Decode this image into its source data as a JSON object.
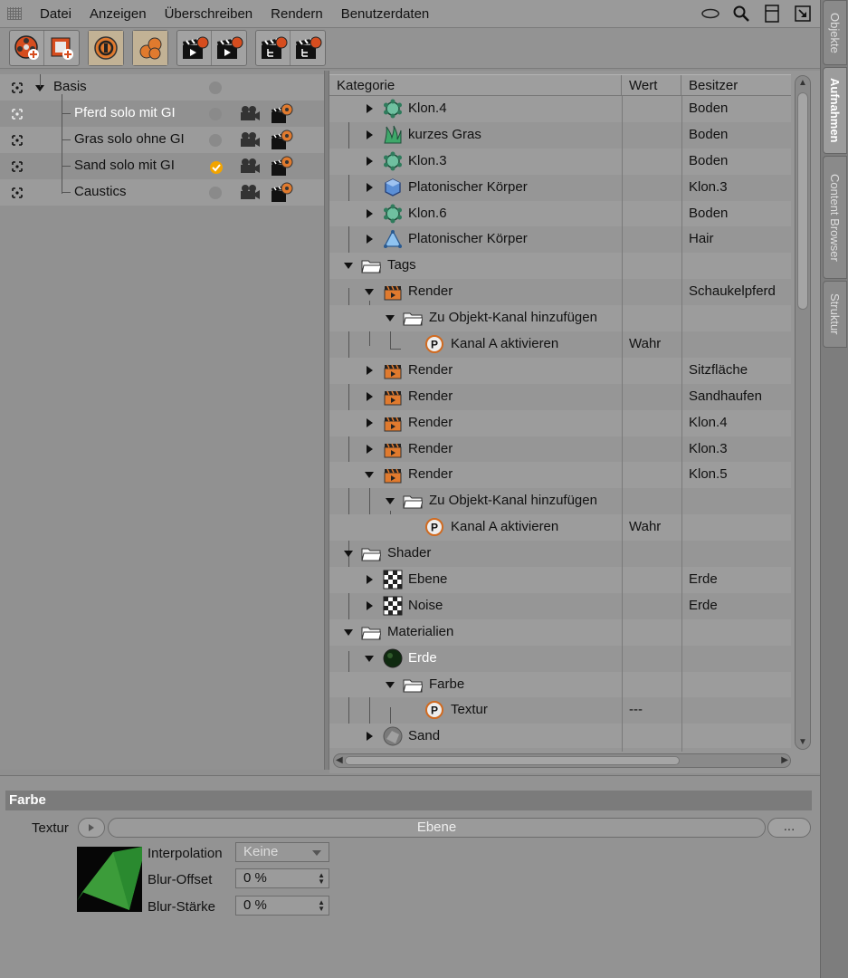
{
  "menubar": {
    "items": [
      "Datei",
      "Anzeigen",
      "Überschreiben",
      "Rendern",
      "Benutzerdaten"
    ]
  },
  "side_tabs": [
    "Objekte",
    "Aufnahmen",
    "Content Browser",
    "Struktur"
  ],
  "takes": [
    {
      "label": "Basis",
      "active": false
    },
    {
      "label": "Pferd solo mit GI",
      "active": true
    },
    {
      "label": "Gras solo ohne GI",
      "active": false
    },
    {
      "label": "Sand solo mit GI",
      "active": false
    },
    {
      "label": "Caustics",
      "active": false
    }
  ],
  "tree": {
    "headers": {
      "category": "Kategorie",
      "value": "Wert",
      "owner": "Besitzer"
    },
    "rows": [
      {
        "name": "Klon.4",
        "owner": "Boden",
        "value": "",
        "icon": "cloner-icon"
      },
      {
        "name": "kurzes Gras",
        "owner": "Boden",
        "value": "",
        "icon": "grass-icon"
      },
      {
        "name": "Klon.3",
        "owner": "Boden",
        "value": "",
        "icon": "cloner-icon"
      },
      {
        "name": "Platonischer Körper",
        "owner": "Klon.3",
        "value": "",
        "icon": "platonic-icon"
      },
      {
        "name": "Klon.6",
        "owner": "Boden",
        "value": "",
        "icon": "cloner-icon"
      },
      {
        "name": "Platonischer Körper",
        "owner": "Hair",
        "value": "",
        "icon": "cone-icon"
      },
      {
        "name": "Tags",
        "owner": "",
        "value": "",
        "icon": "folder-icon"
      },
      {
        "name": "Render",
        "owner": "Schaukelpferd",
        "value": "",
        "icon": "render-tag-icon"
      },
      {
        "name": "Zu Objekt-Kanal hinzufügen",
        "owner": "",
        "value": "",
        "icon": "folder-icon"
      },
      {
        "name": "Kanal A aktivieren",
        "owner": "",
        "value": "Wahr",
        "icon": "parameter-icon"
      },
      {
        "name": "Render",
        "owner": "Sitzfläche",
        "value": "",
        "icon": "render-tag-icon"
      },
      {
        "name": "Render",
        "owner": "Sandhaufen",
        "value": "",
        "icon": "render-tag-icon"
      },
      {
        "name": "Render",
        "owner": "Klon.4",
        "value": "",
        "icon": "render-tag-icon"
      },
      {
        "name": "Render",
        "owner": "Klon.3",
        "value": "",
        "icon": "render-tag-icon"
      },
      {
        "name": "Render",
        "owner": "Klon.5",
        "value": "",
        "icon": "render-tag-icon"
      },
      {
        "name": "Zu Objekt-Kanal hinzufügen",
        "owner": "",
        "value": "",
        "icon": "folder-icon"
      },
      {
        "name": "Kanal A aktivieren",
        "owner": "",
        "value": "Wahr",
        "icon": "parameter-icon"
      },
      {
        "name": "Shader",
        "owner": "",
        "value": "",
        "icon": "folder-icon"
      },
      {
        "name": "Ebene",
        "owner": "Erde",
        "value": "",
        "icon": "checker-icon"
      },
      {
        "name": "Noise",
        "owner": "Erde",
        "value": "",
        "icon": "checker-icon"
      },
      {
        "name": "Materialien",
        "owner": "",
        "value": "",
        "icon": "folder-icon"
      },
      {
        "name": "Erde",
        "owner": "",
        "value": "",
        "icon": "material-icon"
      },
      {
        "name": "Farbe",
        "owner": "",
        "value": "",
        "icon": "folder-icon"
      },
      {
        "name": "Textur",
        "owner": "",
        "value": "---",
        "icon": "parameter-icon"
      },
      {
        "name": "Sand",
        "owner": "",
        "value": "",
        "icon": "material-icon"
      }
    ]
  },
  "attributes": {
    "section_title": "Farbe",
    "texture_label": "Textur",
    "texture_value": "Ebene",
    "more_button": "...",
    "interpolation_label": "Interpolation",
    "interpolation_value": "Keine",
    "blur_offset_label": "Blur-Offset",
    "blur_offset_value": "0 %",
    "blur_strength_label": "Blur-Stärke",
    "blur_strength_value": "0 %"
  },
  "colors": {
    "accent": "#e07a2e",
    "check": "#f2a400",
    "highlight_text": "#ffffff"
  }
}
